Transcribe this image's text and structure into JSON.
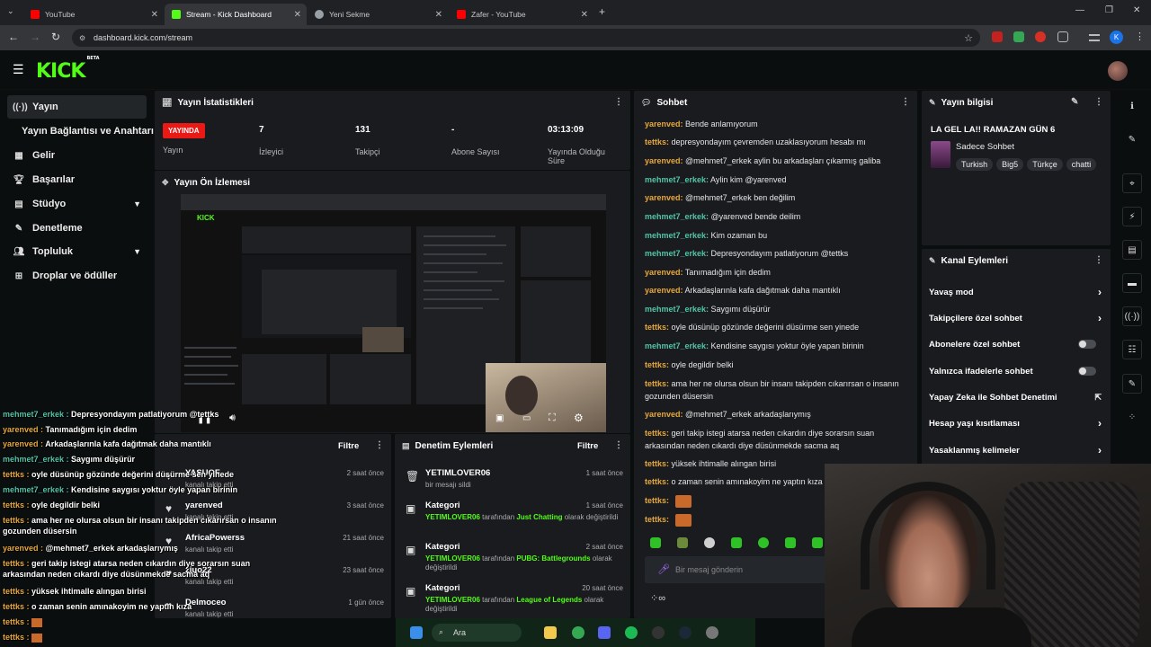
{
  "browser": {
    "tabs": [
      {
        "label": "YouTube",
        "color": "#ff0000"
      },
      {
        "label": "Stream - Kick Dashboard",
        "color": "#53fc18"
      },
      {
        "label": "Yeni Sekme",
        "color": "#9aa0a6"
      },
      {
        "label": "Zafer - YouTube",
        "color": "#ff0000"
      }
    ],
    "url": "dashboard.kick.com/stream",
    "profile_initial": "K"
  },
  "brand": {
    "logo": "KICK",
    "badge": "BETA",
    "accent": "#53fc18"
  },
  "sidebar": {
    "items": [
      {
        "label": "Yayın",
        "icon": "broadcast-icon"
      },
      {
        "label": "Yayın Bağlantısı ve Anahtarı",
        "icon": ""
      },
      {
        "label": "Gelir",
        "icon": "dollar-icon"
      },
      {
        "label": "Başarılar",
        "icon": "trophy-icon"
      },
      {
        "label": "Stüdyo",
        "icon": "grid-icon"
      },
      {
        "label": "Denetleme",
        "icon": "wrench-icon"
      },
      {
        "label": "Topluluk",
        "icon": "people-icon"
      },
      {
        "label": "Droplar ve ödüller",
        "icon": "gift-icon"
      }
    ]
  },
  "stats": {
    "title": "Yayın İstatistikleri",
    "live_badge": "YAYINDA",
    "cells": [
      {
        "value": "",
        "label": "Yayın"
      },
      {
        "value": "7",
        "label": "İzleyici"
      },
      {
        "value": "131",
        "label": "Takipçi"
      },
      {
        "value": "-",
        "label": "Abone Sayısı"
      },
      {
        "value": "03:13:09",
        "label": "Yayında Olduğu Süre"
      }
    ]
  },
  "preview": {
    "title": "Yayın Ön İzlemesi"
  },
  "followers": {
    "filter": "Filtre",
    "rows": [
      {
        "name": "YASUOF",
        "sub": "kanalı takip etti",
        "time": "2 saat önce"
      },
      {
        "name": "yarenved",
        "sub": "kanalı takip etti",
        "time": "3 saat önce"
      },
      {
        "name": "AfricaPowerss",
        "sub": "kanalı takip etti",
        "time": "21 saat önce"
      },
      {
        "name": "ziuo22",
        "sub": "kanalı takip etti",
        "time": "23 saat önce"
      },
      {
        "name": "Delmoceo",
        "sub": "kanalı takip etti",
        "time": "1 gün önce"
      }
    ]
  },
  "moderation": {
    "title": "Denetim Eylemleri",
    "filter": "Filtre",
    "rows": [
      {
        "title": "YETIMLOVER06",
        "sub_pre": "bir mesajı sildi",
        "sub_hl": "",
        "sub_post": "",
        "time": "1 saat önce"
      },
      {
        "title": "Kategori",
        "sub_pre": "YETIMLOVER06",
        "sub_mid": " tarafından ",
        "sub_hl": "Just Chatting",
        "sub_post": " olarak değiştirildi",
        "time": "1 saat önce"
      },
      {
        "title": "Kategori",
        "sub_pre": "YETIMLOVER06",
        "sub_mid": " tarafından ",
        "sub_hl": "PUBG: Battlegrounds",
        "sub_post": " olarak değiştirildi",
        "time": "2 saat önce"
      },
      {
        "title": "Kategori",
        "sub_pre": "YETIMLOVER06",
        "sub_mid": " tarafından ",
        "sub_hl": "League of Legends",
        "sub_post": " olarak değiştirildi",
        "time": "20 saat önce"
      }
    ]
  },
  "chat": {
    "title": "Sohbet",
    "input_placeholder": "Bir mesaj gönderin",
    "messages": [
      {
        "user": "yarenved",
        "color": "#e8a93b",
        "text": "Bende anlamıyorum"
      },
      {
        "user": "tettks",
        "color": "#e8a93b",
        "text": "depresyondayım çevremden uzaklasıyorum hesabı mı"
      },
      {
        "user": "yarenved",
        "color": "#e8a93b",
        "text": "@mehmet7_erkek aylin bu arkadaşları çıkarmış galiba"
      },
      {
        "user": "mehmet7_erkek",
        "color": "#53c4a8",
        "text": "Aylin kim @yarenved"
      },
      {
        "user": "yarenved",
        "color": "#e8a93b",
        "text": "@mehmet7_erkek ben değilim"
      },
      {
        "user": "mehmet7_erkek",
        "color": "#53c4a8",
        "text": "@yarenved bende deilim"
      },
      {
        "user": "mehmet7_erkek",
        "color": "#53c4a8",
        "text": "Kim ozaman bu"
      },
      {
        "user": "mehmet7_erkek",
        "color": "#53c4a8",
        "text": "Depresyondayım patlatiyorum @tettks"
      },
      {
        "user": "yarenved",
        "color": "#e8a93b",
        "text": "Tanımadığım için dedim"
      },
      {
        "user": "yarenved",
        "color": "#e8a93b",
        "text": "Arkadaşlarınla kafa dağıtmak daha mantıklı"
      },
      {
        "user": "mehmet7_erkek",
        "color": "#53c4a8",
        "text": "Saygımı düşürür"
      },
      {
        "user": "tettks",
        "color": "#e8a93b",
        "text": "oyle düsünüp gözünde değerini düsürme sen yinede"
      },
      {
        "user": "mehmet7_erkek",
        "color": "#53c4a8",
        "text": "Kendisine saygısı yoktur öyle yapan birinin"
      },
      {
        "user": "tettks",
        "color": "#e8a93b",
        "text": "oyle degildir belki"
      },
      {
        "user": "tettks",
        "color": "#e8a93b",
        "text": "ama her ne olursa olsun bir insanı takipden cıkarırsan o insanın gozunden düsersin"
      },
      {
        "user": "yarenved",
        "color": "#e8a93b",
        "text": "@mehmet7_erkek arkadaşlarıymış"
      },
      {
        "user": "tettks",
        "color": "#e8a93b",
        "text": "geri takip istegi atarsa neden cıkardın diye sorarsın suan arkasından neden cıkardı diye düsünmekde sacma aq"
      },
      {
        "user": "tettks",
        "color": "#e8a93b",
        "text": "yüksek ihtimalle alıngan birisi"
      },
      {
        "user": "tettks",
        "color": "#e8a93b",
        "text": "o zaman senin amınakoyim ne yaptın kıza"
      },
      {
        "user": "tettks",
        "color": "#e8a93b",
        "text": ""
      },
      {
        "user": "tettks",
        "color": "#e8a93b",
        "text": ""
      }
    ]
  },
  "stream_info": {
    "title": "Yayın bilgisi",
    "stream_title": "LA GEL LA!! RAMAZAN GÜN 6",
    "category": "Sadece Sohbet",
    "tags": [
      "Turkish",
      "Big5",
      "Türkçe",
      "chatti"
    ]
  },
  "channel_actions": {
    "title": "Kanal Eylemleri",
    "items": [
      {
        "label": "Yavaş mod",
        "control": "chevron"
      },
      {
        "label": "Takipçilere özel sohbet",
        "control": "chevron"
      },
      {
        "label": "Abonelere özel sohbet",
        "control": "toggle"
      },
      {
        "label": "Yalnızca ifadelerle sohbet",
        "control": "toggle"
      },
      {
        "label": "Yapay Zeka ile Sohbet Denetimi",
        "control": "external"
      },
      {
        "label": "Hesap yaşı kısıtlaması",
        "control": "chevron"
      },
      {
        "label": "Yasaklanmış kelimeler",
        "control": "chevron"
      }
    ]
  },
  "overlay_chat": [
    {
      "user": "mehmet7_erkek",
      "color": "#53c4a8",
      "text": "Depresyondayım patlatiyorum @tettks"
    },
    {
      "user": "yarenved",
      "color": "#e8a93b",
      "text": "Tanımadığım için dedim"
    },
    {
      "user": "yarenved",
      "color": "#e8a93b",
      "text": "Arkadaşlarınla kafa dağıtmak daha mantıklı"
    },
    {
      "user": "mehmet7_erkek",
      "color": "#53c4a8",
      "text": "Saygımı düşürür"
    },
    {
      "user": "tettks",
      "color": "#e8a93b",
      "text": "oyle düsünüp gözünde değerini düsürme sen yinede"
    },
    {
      "user": "mehmet7_erkek",
      "color": "#53c4a8",
      "text": "Kendisine saygısı yoktur öyle yapan birinin"
    },
    {
      "user": "tettks",
      "color": "#e8a93b",
      "text": "oyle degildir belki"
    },
    {
      "user": "tettks",
      "color": "#e8a93b",
      "text": "ama her ne olursa olsun bir insanı takipden cıkarırsan o insanın gozunden düsersin"
    },
    {
      "user": "yarenved",
      "color": "#e8a93b",
      "text": "@mehmet7_erkek arkadaşlarıymış"
    },
    {
      "user": "tettks",
      "color": "#e8a93b",
      "text": "geri takip istegi atarsa neden cıkardın diye sorarsın suan arkasından neden cıkardı diye düsünmekde sacma aq"
    },
    {
      "user": "tettks",
      "color": "#e8a93b",
      "text": "yüksek ihtimalle alıngan birisi"
    },
    {
      "user": "tettks",
      "color": "#e8a93b",
      "text": "o zaman senin amınakoyim ne yaptın kıza"
    },
    {
      "user": "tettks",
      "color": "#e8a93b",
      "text": ""
    },
    {
      "user": "tettks",
      "color": "#e8a93b",
      "text": ""
    }
  ],
  "taskbar": {
    "search": "Ara"
  }
}
